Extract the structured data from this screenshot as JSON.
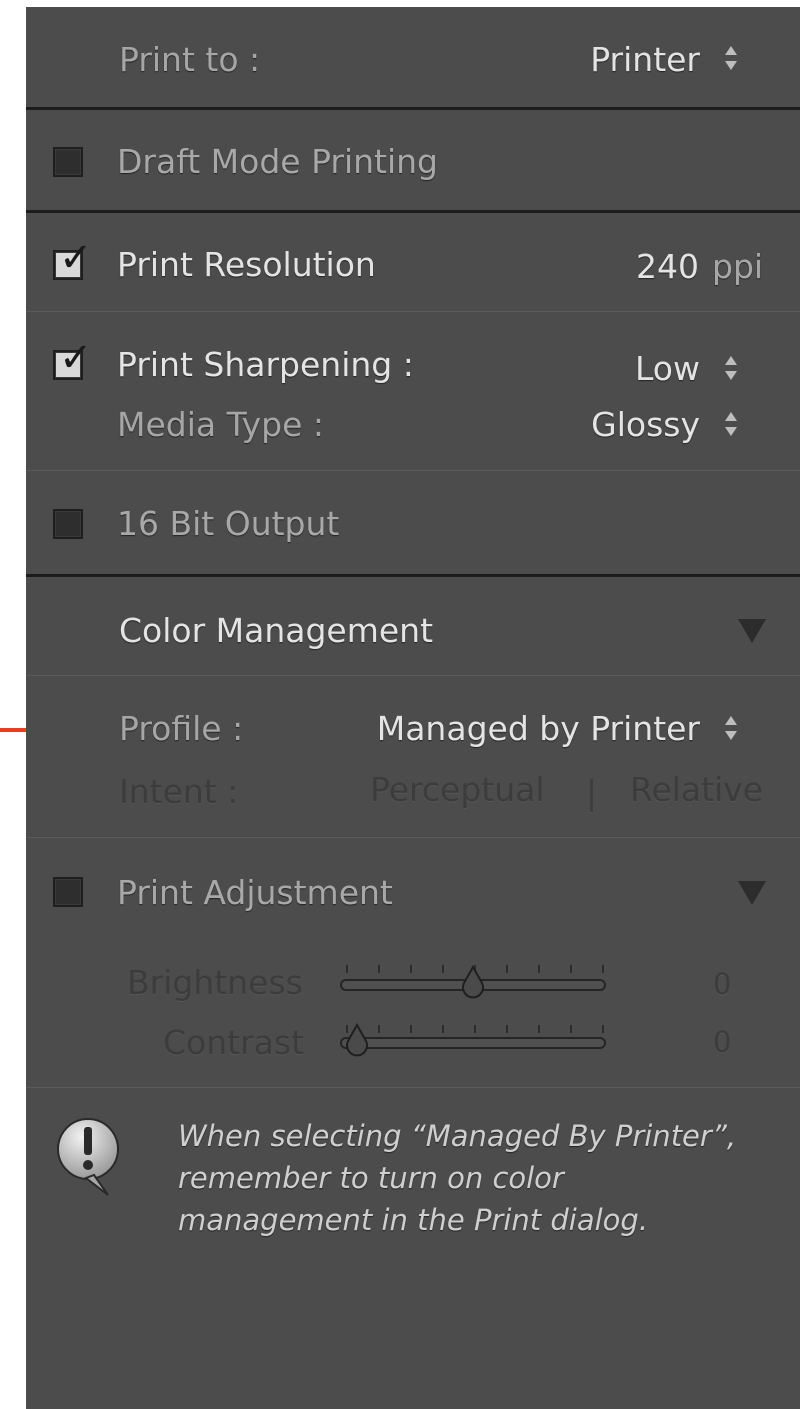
{
  "print_job": {
    "print_to_label": "Print to :",
    "print_to_value": "Printer",
    "draft_mode": {
      "label": "Draft Mode Printing",
      "checked": false
    },
    "resolution": {
      "label": "Print Resolution",
      "checked": true,
      "value": "240",
      "unit": "ppi"
    },
    "sharpening": {
      "label": "Print Sharpening :",
      "checked": true,
      "value": "Low"
    },
    "media_type": {
      "label": "Media Type :",
      "value": "Glossy"
    },
    "bit_output": {
      "label": "16 Bit Output",
      "checked": false
    }
  },
  "color_management": {
    "title": "Color Management",
    "profile_label": "Profile :",
    "profile_value": "Managed by Printer",
    "intent_label": "Intent :",
    "intent_perceptual": "Perceptual",
    "intent_separator": "|",
    "intent_relative": "Relative"
  },
  "print_adjustment": {
    "label": "Print Adjustment",
    "checked": false,
    "brightness_label": "Brightness",
    "brightness_value": "0",
    "brightness_level": 0.5,
    "contrast_label": "Contrast",
    "contrast_value": "0",
    "contrast_level": 0.0
  },
  "notice": {
    "icon": "exclamation-bubble-icon",
    "line1": "When selecting “Managed By Printer”,",
    "line2": "remember to turn on color",
    "line3": "management in the Print dialog."
  },
  "colors": {
    "panel_bg": "#4c4c4c",
    "arrow": "#e8401c"
  }
}
